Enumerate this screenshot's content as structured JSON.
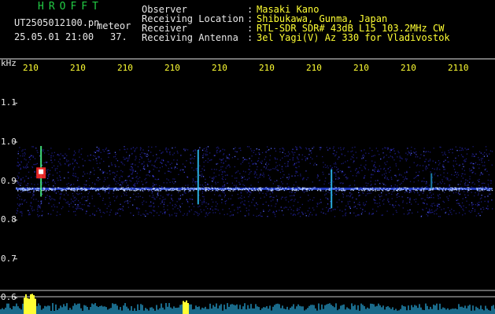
{
  "app_title": "HROFFT",
  "file_name": "UT2505012100.pn",
  "file_tag": "meteor",
  "timestamp": "25.05.01 21:00",
  "count": "37.",
  "info": [
    {
      "label": "Observer",
      "value": "Masaki Kano"
    },
    {
      "label": "Receiving Location",
      "value": "Shibukawa, Gunma, Japan"
    },
    {
      "label": "Receiver",
      "value": "RTL-SDR SDR# 43dB L15 103.2MHz CW"
    },
    {
      "label": "Receiving Antenna",
      "value": "3el Yagi(V) Az 330 for Vladivostok"
    }
  ],
  "colors": {
    "label_text": "#e8e8e8",
    "value_text": "#ffff33",
    "title_text": "#22cc44",
    "axis_text": "#ffff33"
  },
  "chart_data": {
    "type": "heatmap",
    "ylabel": "kHz",
    "y_ticks": [
      "1.1",
      "1.0",
      "0.9",
      "0.8",
      "0.7",
      "0.6"
    ],
    "x_ticks": [
      "210",
      "210",
      "210",
      "210",
      "210",
      "210",
      "210",
      "210",
      "210",
      "2110"
    ],
    "background_band_khz": [
      0.81,
      0.99
    ],
    "carrier_khz": 0.88,
    "bursts": [
      {
        "x_index": 0.3,
        "khz_range": [
          0.86,
          0.99
        ],
        "strength": "strong"
      },
      {
        "x_index": 3.6,
        "khz_range": [
          0.84,
          0.98
        ],
        "strength": "medium"
      },
      {
        "x_index": 6.4,
        "khz_range": [
          0.83,
          0.93
        ],
        "strength": "medium"
      },
      {
        "x_index": 8.5,
        "khz_range": [
          0.88,
          0.92
        ],
        "strength": "weak"
      }
    ],
    "grid": "none"
  }
}
